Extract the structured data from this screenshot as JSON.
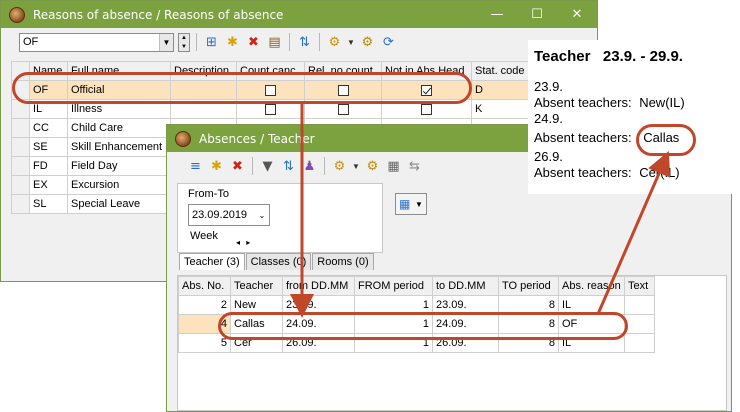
{
  "reasons_window": {
    "title": "Reasons of absence / Reasons of absence",
    "filter_value": "OF",
    "columns": [
      "Name",
      "Full name",
      "Description",
      "Count canc.",
      "Rel. no count",
      "Not in Abs.Head",
      "Stat. code"
    ],
    "rows": [
      {
        "name": "OF",
        "full": "Official",
        "desc": "",
        "count_canc": false,
        "rel_no_count": false,
        "not_in_abs_head": true,
        "stat": "D"
      },
      {
        "name": "IL",
        "full": "Illness",
        "desc": "",
        "count_canc": false,
        "rel_no_count": false,
        "not_in_abs_head": false,
        "stat": "K"
      },
      {
        "name": "CC",
        "full": "Child Care",
        "desc": "",
        "count_canc": null,
        "rel_no_count": null,
        "not_in_abs_head": null,
        "stat": ""
      },
      {
        "name": "SE",
        "full": "Skill Enhancement",
        "desc": "",
        "count_canc": null,
        "rel_no_count": null,
        "not_in_abs_head": null,
        "stat": ""
      },
      {
        "name": "FD",
        "full": "Field Day",
        "desc": "",
        "count_canc": null,
        "rel_no_count": null,
        "not_in_abs_head": null,
        "stat": ""
      },
      {
        "name": "EX",
        "full": "Excursion",
        "desc": "",
        "count_canc": null,
        "rel_no_count": null,
        "not_in_abs_head": null,
        "stat": ""
      },
      {
        "name": "SL",
        "full": "Special Leave",
        "desc": "",
        "count_canc": null,
        "rel_no_count": null,
        "not_in_abs_head": null,
        "stat": ""
      }
    ]
  },
  "absences_window": {
    "title": "Absences / Teacher",
    "from_to_label": "From-To",
    "date_value": "23.09.2019",
    "week_label": "Week",
    "week_arrows": "◂ ▸",
    "tabs": [
      "Teacher (3)",
      "Classes (0)",
      "Rooms (0)"
    ],
    "columns": [
      "Abs. No.",
      "Teacher",
      "from DD.MM",
      "FROM period",
      "to DD.MM",
      "TO period",
      "Abs. reason",
      "Text"
    ],
    "rows": [
      {
        "no": "2",
        "teacher": "New",
        "from": "23.09.",
        "from_p": "1",
        "to": "23.09.",
        "to_p": "8",
        "reason": "IL",
        "text": ""
      },
      {
        "no": "4",
        "teacher": "Callas",
        "from": "24.09.",
        "from_p": "1",
        "to": "24.09.",
        "to_p": "8",
        "reason": "OF",
        "text": ""
      },
      {
        "no": "5",
        "teacher": "Cer",
        "from": "26.09.",
        "from_p": "1",
        "to": "26.09.",
        "to_p": "8",
        "reason": "IL",
        "text": ""
      }
    ]
  },
  "info_panel": {
    "title": "Teacher   23.9. - 29.9.",
    "days": [
      {
        "date": "23.9.",
        "label": "Absent teachers:",
        "value": "New(IL)"
      },
      {
        "date": "24.9.",
        "label": "Absent teachers:",
        "value": "Callas"
      },
      {
        "date": "26.9.",
        "label": "Absent teachers:",
        "value": "Cer(IL)"
      }
    ]
  },
  "colors": {
    "titlebar": "#7ba23f",
    "highlight": "#c0472a",
    "selected_row": "#fde3bd"
  },
  "icons": [
    "app-icon",
    "minimize-icon",
    "maximize-icon",
    "close-icon",
    "new-grid-icon",
    "new-record-icon",
    "delete-icon",
    "print-icon",
    "sort-icon",
    "settings-icon",
    "gear-icon",
    "refresh-icon",
    "filter-icon",
    "calendar-icon"
  ]
}
